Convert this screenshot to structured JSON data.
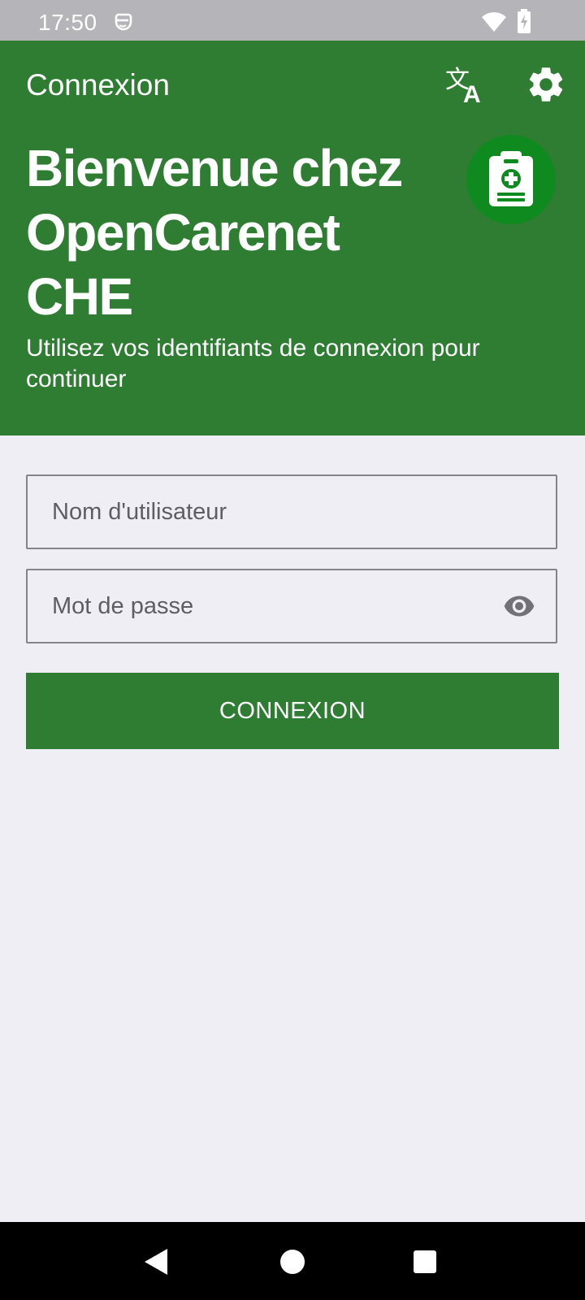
{
  "status_bar": {
    "time": "17:50",
    "icons": [
      "notification-icon",
      "wifi-icon",
      "battery-charging-icon"
    ]
  },
  "header": {
    "title": "Connexion",
    "translate_icon": "translate-icon",
    "settings_icon": "gear-icon",
    "welcome_title": "Bienvenue chez OpenCarenet CHE",
    "welcome_subtitle": "Utilisez vos identifiants de connexion pour continuer",
    "logo_icon": "clipboard-medical-icon"
  },
  "form": {
    "username": {
      "value": "",
      "placeholder": "Nom d'utilisateur"
    },
    "password": {
      "value": "",
      "placeholder": "Mot de passe",
      "toggle_icon": "eye-icon"
    },
    "submit_label": "CONNEXION"
  },
  "navigation": {
    "icons": [
      "back-icon",
      "home-icon",
      "recents-icon"
    ]
  },
  "colors": {
    "primary": "#2e7d32",
    "logo_bg": "#0f8a1e",
    "background": "#efeef4",
    "status_bar": "#b5b4b9",
    "nav_bar": "#000000"
  }
}
